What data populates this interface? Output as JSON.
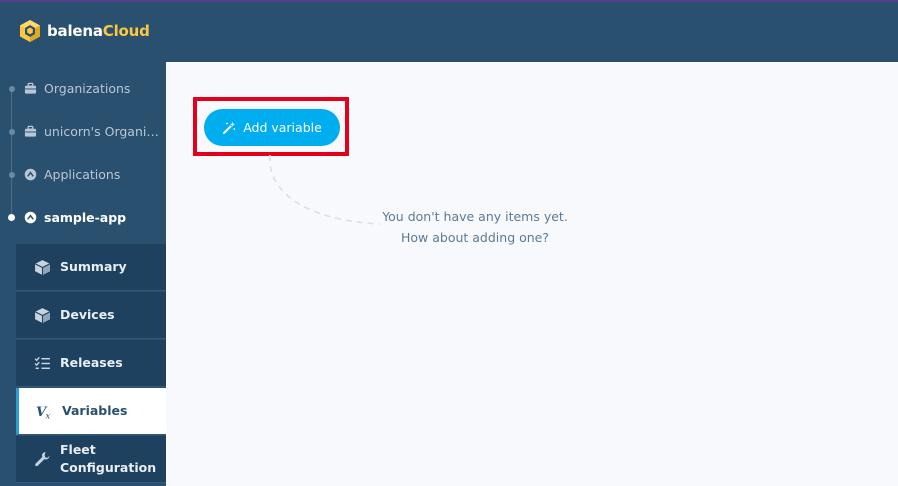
{
  "brand": {
    "name_part1": "balena",
    "name_part2": "Cloud",
    "accent_color": "#fec73f"
  },
  "breadcrumbs": [
    {
      "label": "Organizations",
      "icon": "briefcase-icon"
    },
    {
      "label": "unicorn's Organiz...",
      "icon": "briefcase-icon"
    },
    {
      "label": "Applications",
      "icon": "fleet-icon"
    },
    {
      "label": "sample-app",
      "icon": "fleet-icon",
      "active": true
    }
  ],
  "menu": [
    {
      "label": "Summary",
      "icon": "cube-icon"
    },
    {
      "label": "Devices",
      "icon": "cube-icon"
    },
    {
      "label": "Releases",
      "icon": "list-check-icon"
    },
    {
      "label": "Variables",
      "icon": "variables-icon",
      "selected": true
    },
    {
      "label": "Fleet\nConfiguration",
      "icon": "wrench-icon"
    }
  ],
  "main": {
    "add_button_label": "Add variable",
    "empty_line1": "You don't have any items yet.",
    "empty_line2": "How about adding one?"
  },
  "colors": {
    "sidebar": "#2a506f",
    "primary_button": "#00aeef",
    "highlight_box": "#e2001a"
  }
}
